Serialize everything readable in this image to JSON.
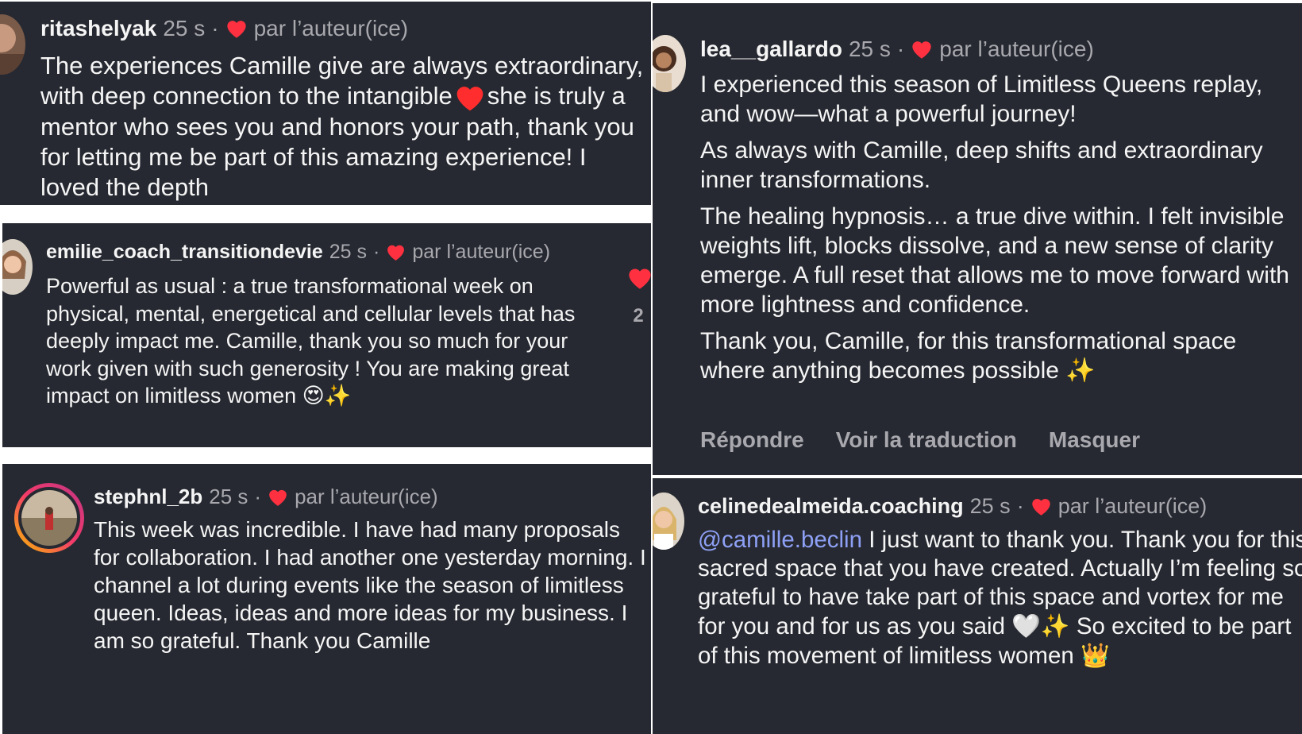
{
  "comments": [
    {
      "username": "ritashelyak",
      "time": "25 s",
      "dot": "·",
      "liked_by": "par l’auteur(ice)",
      "text1": "The experiences Camille give are always extraordinary, with deep connection to the intangible",
      "text2": "she is truly a mentor who sees you and honors your path, thank you for letting me be part of this amazing experience! I loved the depth"
    },
    {
      "username": "emilie_coach_transitiondevie",
      "time": "25 s",
      "dot": "·",
      "liked_by": "par l’auteur(ice)",
      "text": "Powerful as usual : a true transformational week on physical, mental, energetical and cellular levels that has deeply impact me. Camille, thank you so much for your work given with such generosity ! You are making great impact on limitless women",
      "emojis": "😍✨",
      "like_count": "2"
    },
    {
      "username": "stephnl_2b",
      "time": "25 s",
      "dot": "·",
      "liked_by": "par l’auteur(ice)",
      "text": "This week was incredible. I have had many proposals for collaboration. I had another one yesterday morning. I channel a lot during events like the season of limitless queen. Ideas, ideas and more ideas for my business. I am so grateful. Thank you Camille"
    },
    {
      "username": "lea__gallardo",
      "time": "25 s",
      "dot": "·",
      "liked_by": "par l’auteur(ice)",
      "paragraphs": [
        "I experienced this season of Limitless Queens replay, and wow—what a powerful journey!",
        "As always with Camille, deep shifts and extraordinary inner transformations.",
        "The healing hypnosis… a true dive within. I felt invisible weights lift, blocks dissolve, and a new sense of clarity emerge. A full reset that allows me to move forward with more lightness and confidence.",
        "Thank you, Camille, for this transformational space where anything becomes possible ✨"
      ],
      "actions": {
        "reply": "Répondre",
        "translate": "Voir la traduction",
        "hide": "Masquer"
      }
    },
    {
      "username": "celinedealmeida.coaching",
      "time": "25 s",
      "dot": "·",
      "liked_by": "par l’auteur(ice)",
      "mention": "@camille.beclin",
      "text1": " I just want to thank you. Thank you for this sacred space that you have created. Actually I’m feeling so grateful to have take part of this space and vortex for me for you and for us as you said ",
      "emojis1": "🤍✨",
      "text2": " So excited to be part of this movement of limitless women ",
      "emoji2": "👑"
    }
  ],
  "colors": {
    "background": "#262931",
    "heart": "#ff3040",
    "mention": "#8ea0f5",
    "muted": "#a8a8ae"
  },
  "icons": {
    "like": "heart-icon"
  }
}
